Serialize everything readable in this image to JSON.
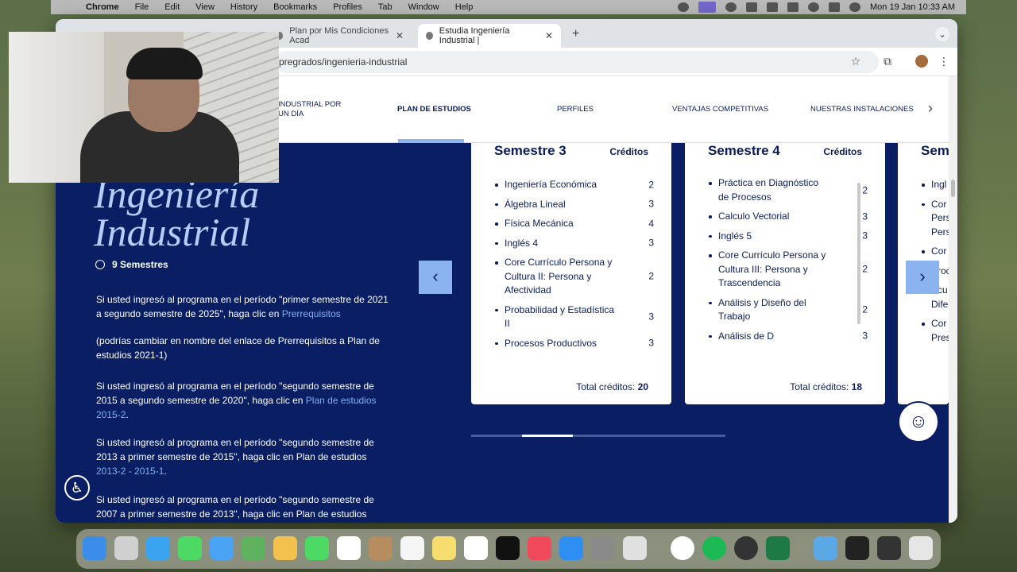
{
  "menubar": {
    "app": "Chrome",
    "items": [
      "File",
      "Edit",
      "View",
      "History",
      "Bookmarks",
      "Profiles",
      "Tab",
      "Window",
      "Help"
    ],
    "clock": "Mon 19 Jan  10:33 AM"
  },
  "browser": {
    "tabs": [
      {
        "title": "Plan por Mis Condiciones Acad"
      },
      {
        "title": "Estudia Ingeniería Industrial |"
      }
    ],
    "address": "pregrados/ingenieria-industrial"
  },
  "subnav": {
    "items": [
      "INDUSTRIAL POR UN DÍA",
      "PLAN DE ESTUDIOS",
      "PERFILES",
      "VENTAJAS COMPETITIVAS",
      "NUESTRAS INSTALACIONES"
    ]
  },
  "hero": {
    "title_line1": "Ingeniería",
    "title_line2": "Industrial",
    "semesters": "9 Semestres"
  },
  "paragraphs": {
    "p1": "Si usted ingresó al programa en el período \"primer semestre de 2021 a segundo semestre de 2025\", haga clic en ",
    "p1_link": "Prerrequisitos",
    "p2": "(podrías cambiar en nombre del enlace de Prerrequisitos a Plan de estudios 2021-1)",
    "p3": "Si usted ingresó al programa en el período \"segundo semestre de 2015 a segundo semestre de 2020\", haga clic en  ",
    "p3_link": "Plan de estudios 2015-2",
    "p3_end": ".",
    "p4": "Si usted ingresó al programa en el período \"segundo semestre de 2013 a primer semestre de 2015\", haga clic en Plan de estudios ",
    "p4_link": "2013-2 - 2015-1",
    "p4_end": ".",
    "p5": "Si usted ingresó al programa en el período \"segundo semestre de 2007 a primer semestre de 2013\", haga clic en Plan de estudios"
  },
  "cards": {
    "credits_label": "Créditos",
    "total_label": "Total créditos:",
    "sem3": {
      "title": "Semestre 3",
      "total": "20",
      "courses": [
        {
          "name": "Ingeniería Económica",
          "credits": "2"
        },
        {
          "name": "Álgebra Lineal",
          "credits": "3"
        },
        {
          "name": "Física Mecánica",
          "credits": "4"
        },
        {
          "name": "Inglés 4",
          "credits": "3"
        },
        {
          "name": "Core Currículo Persona y Cultura II: Persona y Afectividad",
          "credits": "2"
        },
        {
          "name": "Probabilidad y Estadística II",
          "credits": "3"
        },
        {
          "name": "Procesos Productivos",
          "credits": "3"
        }
      ]
    },
    "sem4": {
      "title": "Semestre 4",
      "total": "18",
      "courses": [
        {
          "name": "Práctica en Diagnóstico de Procesos",
          "credits": "2"
        },
        {
          "name": "Calculo Vectorial",
          "credits": "3"
        },
        {
          "name": "Inglés 5",
          "credits": "3"
        },
        {
          "name": "Core Currículo Persona y Cultura III: Persona y Trascendencia",
          "credits": "2"
        },
        {
          "name": " Análisis y Diseño del Trabajo",
          "credits": "2"
        },
        {
          "name": "Análisis de D",
          "credits": "3"
        }
      ]
    },
    "sem5": {
      "title": "Sem",
      "courses": [
        "Ingl",
        "Cor Pers Pers",
        "Cor",
        "Proc",
        "Ecu Dife",
        "Cor Pres"
      ]
    }
  }
}
